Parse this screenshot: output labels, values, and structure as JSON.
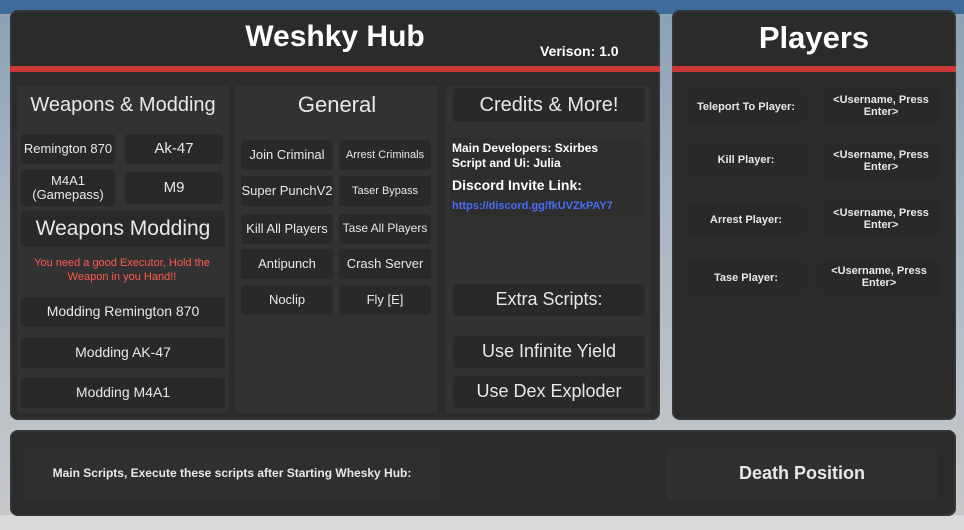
{
  "hub": {
    "title": "Weshky Hub",
    "version": "Verison: 1.0"
  },
  "weapons": {
    "heading": "Weapons & Modding",
    "items": [
      "Remington 870",
      "Ak-47",
      "M4A1\n(Gamepass)",
      "M9"
    ],
    "modding_heading": "Weapons Modding",
    "warning": "You need a good Executor, Hold the Weapon in you Hand!!",
    "modding_items": [
      "Modding Remington 870",
      "Modding AK-47",
      "Modding M4A1"
    ]
  },
  "general": {
    "heading": "General",
    "items": [
      "Join Criminal",
      "Arrest Criminals",
      "Super PunchV2",
      "Taser Bypass",
      "Kill All Players",
      "Tase All Players",
      "Antipunch",
      "Crash Server",
      "Noclip",
      "Fly [E]"
    ]
  },
  "credits": {
    "heading": "Credits & More!",
    "developers": "Main Developers: Sxirbes",
    "script_ui": "Script and Ui: Julia",
    "discord_label": "Discord Invite Link:",
    "discord_link": "https://discord.gg/fkUVZkPAY7",
    "extra_heading": "Extra Scripts:",
    "extra_items": [
      "Use Infinite Yield",
      "Use Dex Exploder"
    ]
  },
  "players": {
    "title": "Players",
    "rows": [
      {
        "label": "Teleport To Player:",
        "placeholder": "<Username, Press Enter>"
      },
      {
        "label": "Kill Player:",
        "placeholder": "<Username, Press Enter>"
      },
      {
        "label": "Arrest Player:",
        "placeholder": "<Username, Press Enter>"
      },
      {
        "label": "Tase Player:",
        "placeholder": "<Username, Press Enter>"
      }
    ]
  },
  "bottom": {
    "main_scripts": "Main Scripts, Execute these scripts after Starting Whesky Hub:",
    "death_position": "Death Position"
  },
  "colors": {
    "accent_red": "#cc3737",
    "warning_red": "#ff5a4e",
    "link_blue": "#4a6cf7"
  }
}
